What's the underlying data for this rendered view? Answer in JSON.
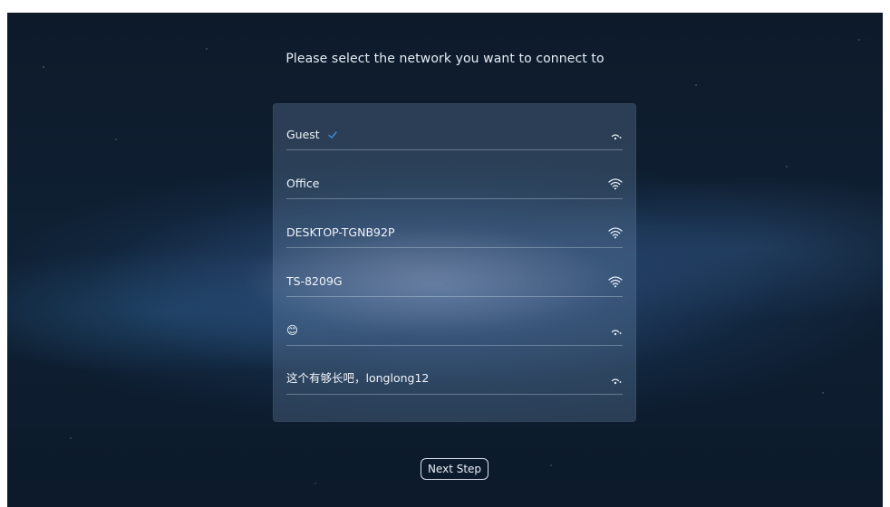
{
  "title": "Please select the network you want to connect to",
  "networks": [
    {
      "name": "Guest",
      "connected": true,
      "signal_icon": "wifi-weak-icon"
    },
    {
      "name": "Office",
      "connected": false,
      "signal_icon": "wifi-full-icon"
    },
    {
      "name": "DESKTOP-TGNB92P",
      "connected": false,
      "signal_icon": "wifi-full-icon"
    },
    {
      "name": "TS-8209G",
      "connected": false,
      "signal_icon": "wifi-full-icon"
    },
    {
      "name": "😊",
      "connected": false,
      "signal_icon": "wifi-weak-icon"
    },
    {
      "name": "这个有够长吧，longlong12",
      "connected": false,
      "signal_icon": "wifi-weak-icon"
    }
  ],
  "next_button": {
    "label": "Next Step"
  },
  "colors": {
    "accent_check": "#3d8fe0",
    "text": "#f0f4fa",
    "panel": "#7896b9"
  }
}
